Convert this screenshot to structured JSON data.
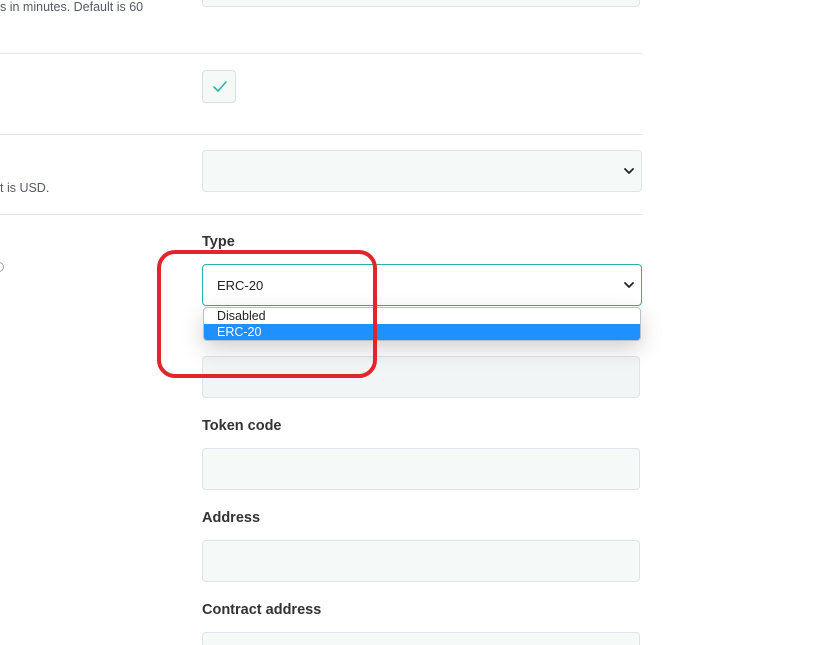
{
  "settings": {
    "timeout_help": "s in minutes. Default is 60",
    "currency_help": "t is USD."
  },
  "checkbox": {
    "checked": true,
    "icon": "check-icon"
  },
  "type_field": {
    "label": "Type",
    "selected_value": "ERC-20",
    "options": [
      "Disabled",
      "ERC-20"
    ],
    "highlight_color": "#e0262a",
    "option_selected_color": "#1e90ff"
  },
  "fields": {
    "token_code_label": "Token code",
    "address_label": "Address",
    "contract_address_label": "Contract address"
  },
  "colors": {
    "accent": "#2bb3a4",
    "input_bg": "#f5faf9"
  }
}
